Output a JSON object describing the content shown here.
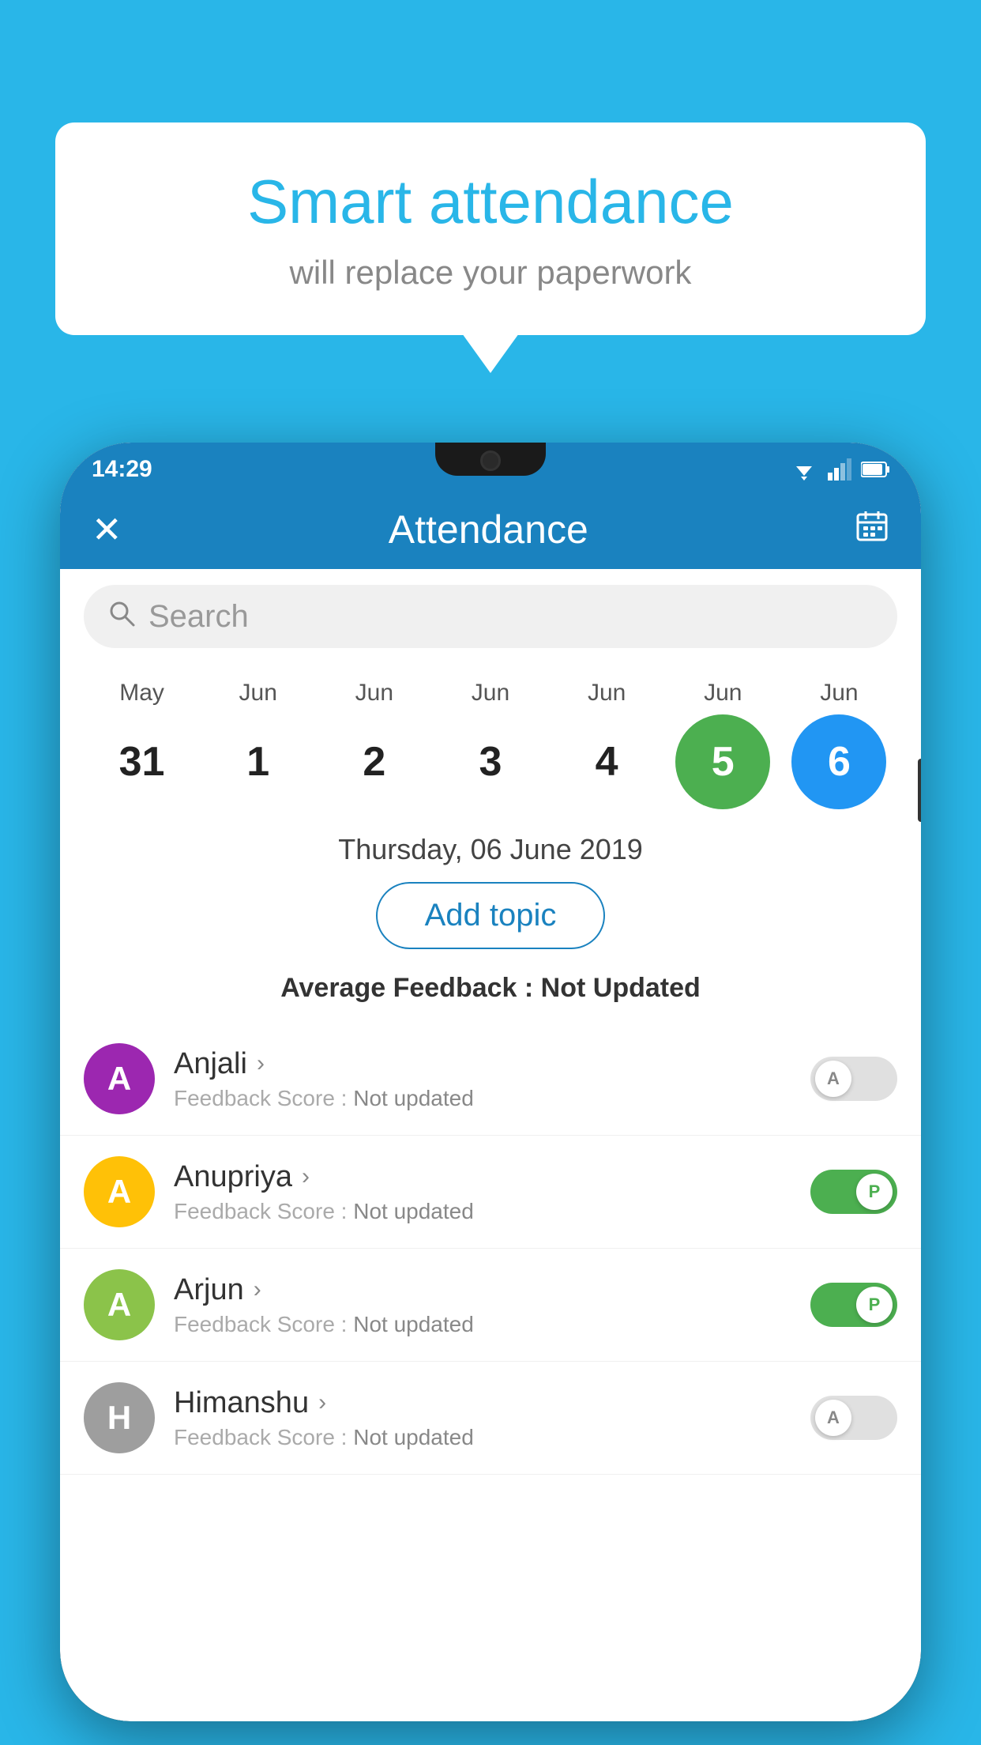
{
  "background_color": "#29b6e8",
  "speech_bubble": {
    "title": "Smart attendance",
    "subtitle": "will replace your paperwork"
  },
  "status_bar": {
    "time": "14:29"
  },
  "app_bar": {
    "title": "Attendance",
    "close_icon": "✕",
    "calendar_icon": "📅"
  },
  "search": {
    "placeholder": "Search"
  },
  "calendar": {
    "months": [
      "May",
      "Jun",
      "Jun",
      "Jun",
      "Jun",
      "Jun",
      "Jun"
    ],
    "days": [
      "31",
      "1",
      "2",
      "3",
      "4",
      "5",
      "6"
    ],
    "today_index": 5,
    "selected_index": 6
  },
  "selected_date": "Thursday, 06 June 2019",
  "add_topic_label": "Add topic",
  "avg_feedback": {
    "label": "Average Feedback : ",
    "value": "Not Updated"
  },
  "students": [
    {
      "name": "Anjali",
      "initial": "A",
      "avatar_color": "#9c27b0",
      "feedback": "Feedback Score : Not updated",
      "attendance": "A",
      "present": false
    },
    {
      "name": "Anupriya",
      "initial": "A",
      "avatar_color": "#ffc107",
      "feedback": "Feedback Score : Not updated",
      "attendance": "P",
      "present": true
    },
    {
      "name": "Arjun",
      "initial": "A",
      "avatar_color": "#8bc34a",
      "feedback": "Feedback Score : Not updated",
      "attendance": "P",
      "present": true
    },
    {
      "name": "Himanshu",
      "initial": "H",
      "avatar_color": "#9e9e9e",
      "feedback": "Feedback Score : Not updated",
      "attendance": "A",
      "present": false
    }
  ]
}
